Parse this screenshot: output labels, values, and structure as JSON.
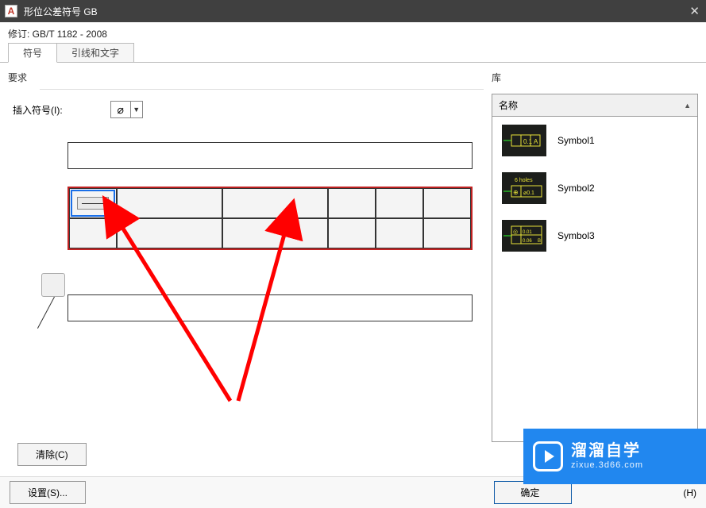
{
  "window": {
    "title": "形位公差符号 GB",
    "close": "✕"
  },
  "revision": "修订: GB/T 1182 - 2008",
  "tabs": {
    "active": "符号",
    "inactive": "引线和文字"
  },
  "left": {
    "group": "要求",
    "insert_label": "插入符号(I):",
    "dropdown_symbol": "⌀",
    "clear": "清除(C)"
  },
  "library": {
    "group": "库",
    "header": "名称",
    "items": [
      {
        "name": "Symbol1"
      },
      {
        "name": "Symbol2",
        "note": "6 holes"
      },
      {
        "name": "Symbol3"
      }
    ]
  },
  "footer": {
    "settings": "设置(S)...",
    "ok": "确定",
    "help_suffix": "(H)"
  },
  "watermark": {
    "brand": "溜溜自学",
    "url": "zixue.3d66.com"
  }
}
